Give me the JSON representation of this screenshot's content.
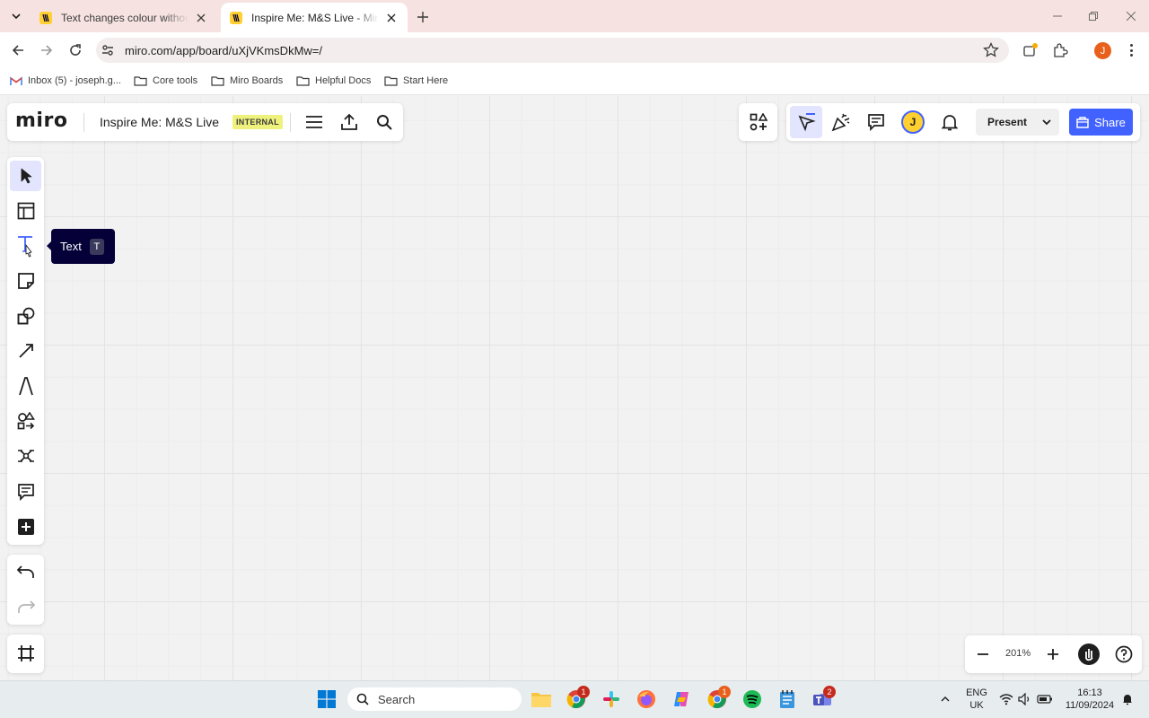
{
  "browser": {
    "tabs": [
      {
        "title": "Text changes colour without me",
        "active": false
      },
      {
        "title": "Inspire Me: M&S Live - Miro",
        "active": true
      }
    ],
    "url": "miro.com/app/board/uXjVKmsDkMw=/",
    "profile_initial": "J",
    "bookmarks": [
      {
        "label": "Inbox (5) - joseph.g...",
        "icon": "gmail-icon"
      },
      {
        "label": "Core tools",
        "icon": "folder-icon"
      },
      {
        "label": "Miro Boards",
        "icon": "folder-icon"
      },
      {
        "label": "Helpful Docs",
        "icon": "folder-icon"
      },
      {
        "label": "Start Here",
        "icon": "folder-icon"
      }
    ]
  },
  "board": {
    "logo": "miro",
    "title": "Inspire Me: M&S Live",
    "badge": "INTERNAL",
    "avatar_initial": "J",
    "present_label": "Present",
    "share_label": "Share",
    "zoom": "201%"
  },
  "tooltip": {
    "label": "Text",
    "shortcut": "T"
  },
  "left_tools": [
    "select-tool",
    "templates-tool",
    "text-tool",
    "sticky-note-tool",
    "shapes-tool",
    "connection-line-tool",
    "pen-tool",
    "diagram-tool",
    "mind-map-tool",
    "comment-tool",
    "more-apps-tool"
  ],
  "taskbar": {
    "search_placeholder": "Search",
    "lang_line1": "ENG",
    "lang_line2": "UK",
    "time": "16:13",
    "date": "11/09/2024",
    "chrome_badge": "1",
    "chrome2_badge": "1",
    "teams_badge": "2"
  },
  "colors": {
    "accent": "#4262ff",
    "tooltip_bg": "#050038",
    "badge_bg": "#eef27c",
    "miro_yellow": "#ffd02f"
  }
}
